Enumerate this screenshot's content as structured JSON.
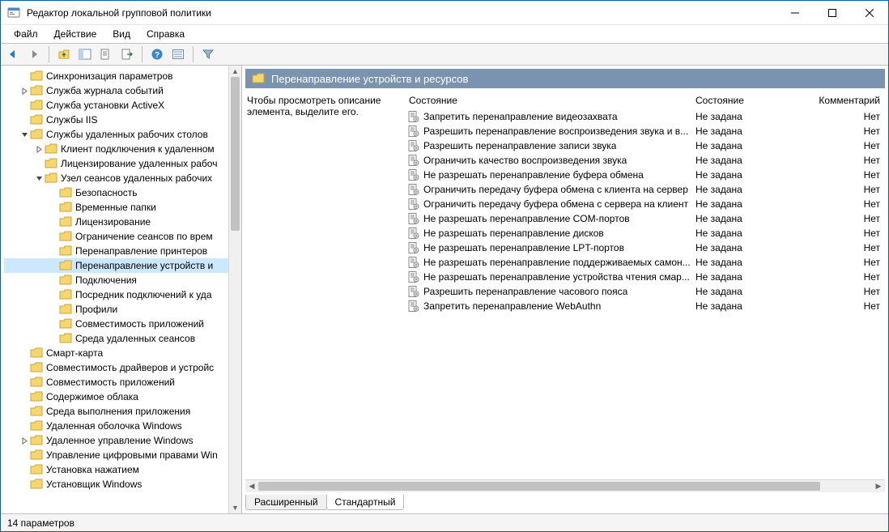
{
  "window": {
    "title": "Редактор локальной групповой политики"
  },
  "menu": {
    "file": "Файл",
    "action": "Действие",
    "view": "Вид",
    "help": "Справка"
  },
  "tree": {
    "items": [
      {
        "ind": 1,
        "tw": "",
        "label": "Синхронизация параметров"
      },
      {
        "ind": 1,
        "tw": ">",
        "label": "Служба журнала событий"
      },
      {
        "ind": 1,
        "tw": "",
        "label": "Служба установки ActiveX"
      },
      {
        "ind": 1,
        "tw": "",
        "label": "Службы IIS"
      },
      {
        "ind": 1,
        "tw": "v",
        "label": "Службы удаленных рабочих столов"
      },
      {
        "ind": 2,
        "tw": ">",
        "label": "Клиент подключения к удаленном"
      },
      {
        "ind": 2,
        "tw": "",
        "label": "Лицензирование удаленных рабоч"
      },
      {
        "ind": 2,
        "tw": "v",
        "label": "Узел сеансов удаленных рабочих"
      },
      {
        "ind": 3,
        "tw": "",
        "label": "Безопасность"
      },
      {
        "ind": 3,
        "tw": "",
        "label": "Временные папки"
      },
      {
        "ind": 3,
        "tw": "",
        "label": "Лицензирование"
      },
      {
        "ind": 3,
        "tw": "",
        "label": "Ограничение сеансов по врем"
      },
      {
        "ind": 3,
        "tw": "",
        "label": "Перенаправление принтеров"
      },
      {
        "ind": 3,
        "tw": "",
        "label": "Перенаправление устройств и",
        "sel": true
      },
      {
        "ind": 3,
        "tw": "",
        "label": "Подключения"
      },
      {
        "ind": 3,
        "tw": "",
        "label": "Посредник подключений к уда"
      },
      {
        "ind": 3,
        "tw": "",
        "label": "Профили"
      },
      {
        "ind": 3,
        "tw": "",
        "label": "Совместимость приложений"
      },
      {
        "ind": 3,
        "tw": "",
        "label": "Среда удаленных сеансов"
      },
      {
        "ind": 1,
        "tw": "",
        "label": "Смарт-карта"
      },
      {
        "ind": 1,
        "tw": "",
        "label": "Совместимость драйверов и устройс"
      },
      {
        "ind": 1,
        "tw": "",
        "label": "Совместимость приложений"
      },
      {
        "ind": 1,
        "tw": "",
        "label": "Содержимое облака"
      },
      {
        "ind": 1,
        "tw": "",
        "label": "Среда выполнения приложения"
      },
      {
        "ind": 1,
        "tw": "",
        "label": "Удаленная оболочка Windows"
      },
      {
        "ind": 1,
        "tw": ">",
        "label": "Удаленное управление Windows"
      },
      {
        "ind": 1,
        "tw": "",
        "label": "Управление цифровыми правами Win"
      },
      {
        "ind": 1,
        "tw": "",
        "label": "Установка нажатием"
      },
      {
        "ind": 1,
        "tw": "",
        "label": "Установщик Windows"
      }
    ]
  },
  "category": {
    "title": "Перенаправление устройств и ресурсов"
  },
  "desc": {
    "text": "Чтобы просмотреть описание элемента, выделите его."
  },
  "columns": {
    "state_header": "Состояние",
    "state": "Состояние",
    "comment": "Комментарий"
  },
  "policies": [
    {
      "name": "Запретить перенаправление видеозахвата",
      "state": "Не задана",
      "comment": "Нет"
    },
    {
      "name": "Разрешить перенаправление воспроизведения звука и в...",
      "state": "Не задана",
      "comment": "Нет"
    },
    {
      "name": "Разрешить перенаправление записи звука",
      "state": "Не задана",
      "comment": "Нет"
    },
    {
      "name": "Ограничить качество воспроизведения звука",
      "state": "Не задана",
      "comment": "Нет"
    },
    {
      "name": "Не разрешать перенаправление буфера обмена",
      "state": "Не задана",
      "comment": "Нет"
    },
    {
      "name": "Ограничить передачу буфера обмена с клиента на сервер",
      "state": "Не задана",
      "comment": "Нет"
    },
    {
      "name": "Ограничить передачу буфера обмена с сервера на клиент",
      "state": "Не задана",
      "comment": "Нет"
    },
    {
      "name": "Не разрешать перенаправление COM-портов",
      "state": "Не задана",
      "comment": "Нет"
    },
    {
      "name": "Не разрешать перенаправление дисков",
      "state": "Не задана",
      "comment": "Нет"
    },
    {
      "name": "Не разрешать перенаправление LPT-портов",
      "state": "Не задана",
      "comment": "Нет"
    },
    {
      "name": "Не разрешать перенаправление поддерживаемых самон...",
      "state": "Не задана",
      "comment": "Нет"
    },
    {
      "name": "Не разрешать перенаправление устройства чтения смар...",
      "state": "Не задана",
      "comment": "Нет"
    },
    {
      "name": "Разрешить перенаправление часового пояса",
      "state": "Не задана",
      "comment": "Нет"
    },
    {
      "name": "Запретить перенаправление WebAuthn",
      "state": "Не задана",
      "comment": "Нет"
    }
  ],
  "tabs": {
    "extended": "Расширенный",
    "standard": "Стандартный"
  },
  "status": {
    "count": "14 параметров"
  }
}
